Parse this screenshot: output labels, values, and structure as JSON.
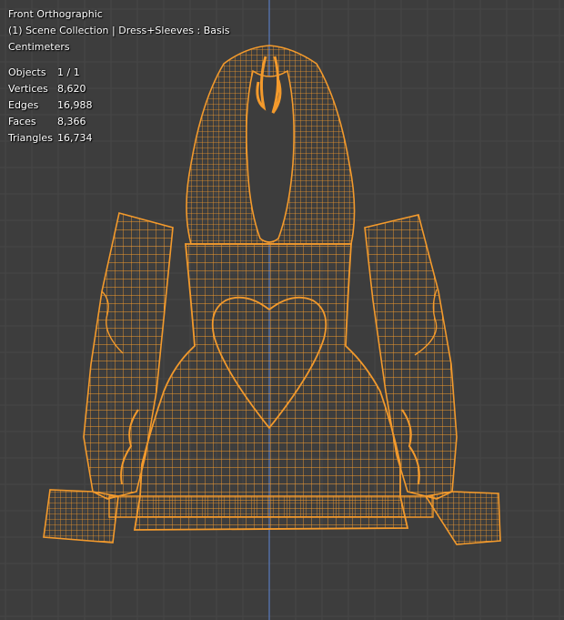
{
  "viewport": {
    "view_name": "Front Orthographic",
    "collection_line": "(1) Scene Collection | Dress+Sleeves : Basis",
    "units": "Centimeters"
  },
  "stats": [
    {
      "label": "Objects",
      "value": "1 / 1"
    },
    {
      "label": "Vertices",
      "value": "8,620"
    },
    {
      "label": "Edges",
      "value": "16,988"
    },
    {
      "label": "Faces",
      "value": "8,366"
    },
    {
      "label": "Triangles",
      "value": "16,734"
    }
  ],
  "colors": {
    "background": "#3d3d3d",
    "grid": "#474747",
    "axis_z": "#5a7bbd",
    "wire_selected": "#f39a2c",
    "text": "#ffffff"
  },
  "icons": {
    "mesh": "dress-wireframe-mesh"
  }
}
